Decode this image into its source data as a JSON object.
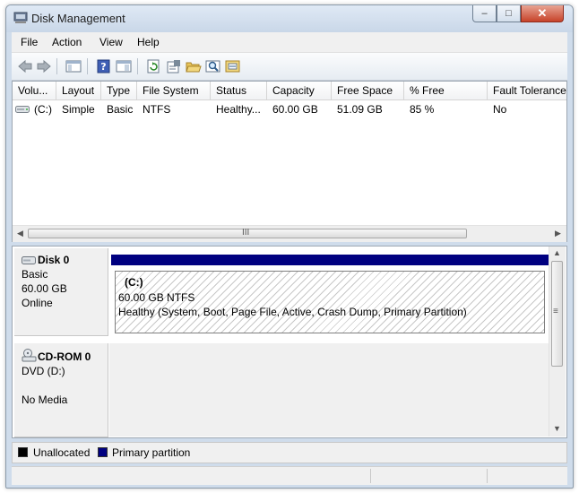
{
  "window": {
    "title": "Disk Management",
    "title_icon": "disk-management-icon",
    "controls": {
      "minimize": "–",
      "maximize": "□",
      "close": "✕"
    }
  },
  "menu": [
    {
      "label": "File"
    },
    {
      "label": "Action"
    },
    {
      "label": "View"
    },
    {
      "label": "Help"
    }
  ],
  "toolbar": {
    "buttons": [
      "back-icon",
      "forward-icon",
      "show-hide-console-tree-icon",
      "help-icon",
      "properties-pane-icon",
      "refresh-icon",
      "properties-icon",
      "open-icon",
      "search-icon",
      "rescan-icon"
    ]
  },
  "volume_list": {
    "columns": [
      "Volu...",
      "Layout",
      "Type",
      "File System",
      "Status",
      "Capacity",
      "Free Space",
      "% Free",
      "Fault Tolerance"
    ],
    "rows": [
      {
        "volume": "(C:)",
        "layout": "Simple",
        "type": "Basic",
        "file_system": "NTFS",
        "status": "Healthy...",
        "capacity": "60.00 GB",
        "free_space": "51.09 GB",
        "percent_free": "85 %",
        "fault_tolerance": "No"
      }
    ],
    "scroll_grip": "III"
  },
  "disks": [
    {
      "name": "Disk 0",
      "type": "Basic",
      "size": "60.00 GB",
      "status": "Online",
      "partition": {
        "label": "(C:)",
        "size_fs": "60.00 GB NTFS",
        "status": "Healthy (System, Boot, Page File, Active, Crash Dump, Primary Partition)"
      }
    },
    {
      "name": "CD-ROM 0",
      "type": "DVD (D:)",
      "media": "No Media"
    }
  ],
  "legend": [
    {
      "label": "Unallocated",
      "color": "#000000"
    },
    {
      "label": "Primary partition",
      "color": "#000080"
    }
  ],
  "scroll_grip_v": "≡"
}
